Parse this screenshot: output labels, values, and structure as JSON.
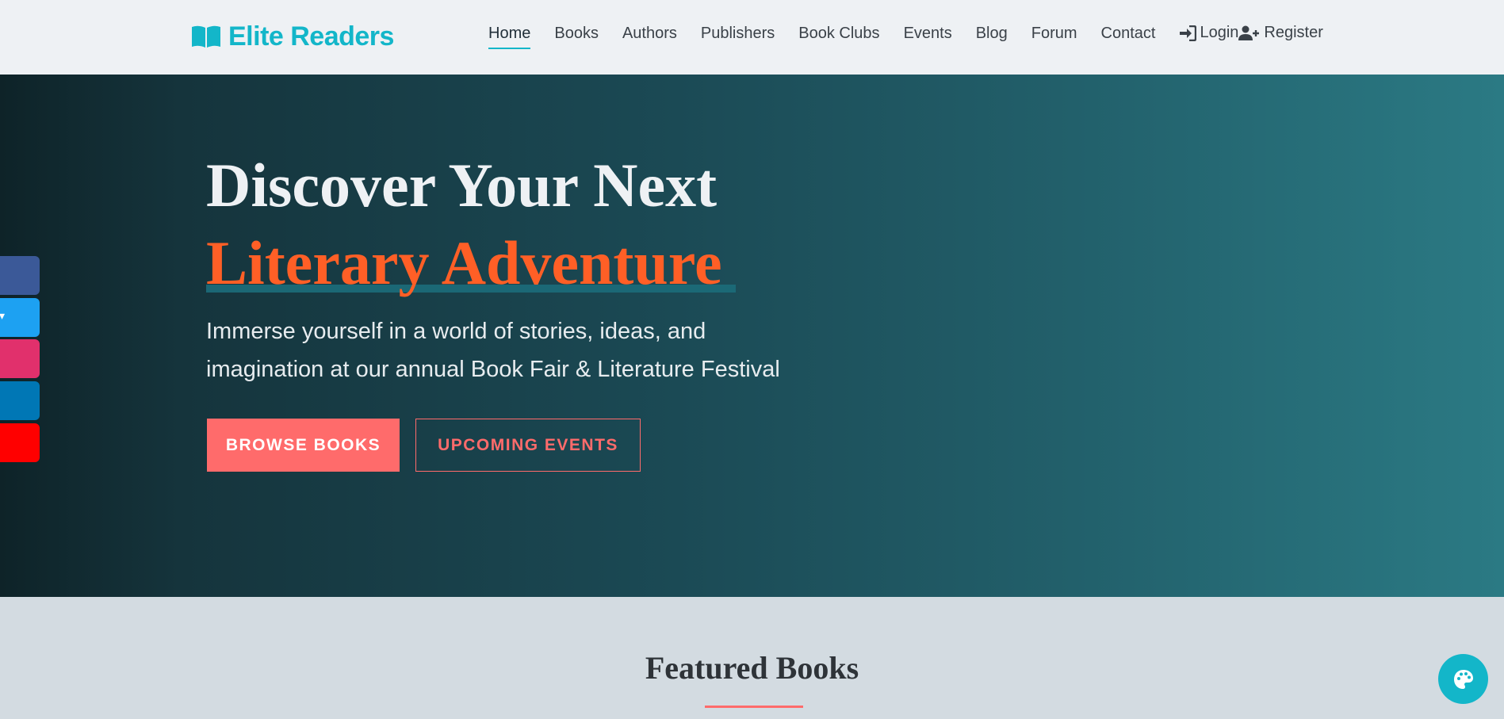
{
  "brand": {
    "name": "Elite Readers",
    "icon": "book-open-icon",
    "color": "#13b6c9"
  },
  "nav": {
    "items": [
      {
        "label": "Home",
        "active": true
      },
      {
        "label": "Books"
      },
      {
        "label": "Authors"
      },
      {
        "label": "Publishers"
      },
      {
        "label": "Book Clubs"
      },
      {
        "label": "Events"
      },
      {
        "label": "Blog"
      },
      {
        "label": "Forum"
      },
      {
        "label": "Contact"
      }
    ],
    "login": {
      "label": "Login",
      "icon": "sign-in-icon"
    },
    "register": {
      "label": "Register",
      "icon": "user-plus-icon"
    }
  },
  "hero": {
    "title": "Discover Your Next",
    "accent": "Literary Adventure",
    "subtitle": "Immerse yourself in a world of stories, ideas, and imagination at our annual Book Fair & Literature Festival",
    "primary_button": "Browse Books",
    "secondary_button": "Upcoming Events",
    "colors": {
      "accent": "#ff5f26",
      "button": "#ff6b6b"
    }
  },
  "social": [
    {
      "name": "facebook",
      "icon": "facebook-icon",
      "color": "#3b5998"
    },
    {
      "name": "twitter",
      "icon": "twitter-icon",
      "color": "#1da1f2"
    },
    {
      "name": "instagram",
      "icon": "instagram-icon",
      "color": "#e1306c"
    },
    {
      "name": "linkedin",
      "icon": "linkedin-icon",
      "color": "#0077b5"
    },
    {
      "name": "youtube",
      "icon": "youtube-icon",
      "color": "#ff0000"
    }
  ],
  "featured": {
    "title": "Featured Books"
  },
  "theme_toggle": {
    "icon": "palette-icon"
  }
}
